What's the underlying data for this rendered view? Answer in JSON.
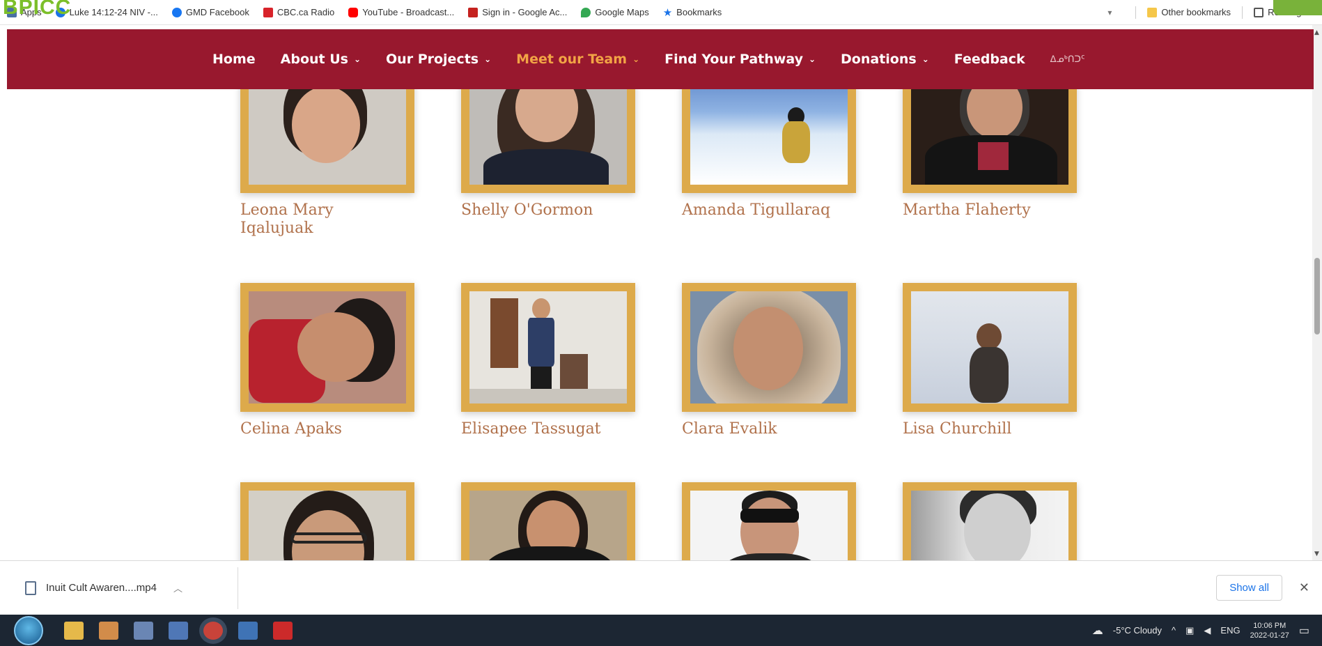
{
  "bookmarks": {
    "items": [
      {
        "label": "Apps",
        "icon": "apps-grid-icon",
        "color": "#4a6fa5"
      },
      {
        "label": "Luke 14:12-24 NIV -...",
        "icon": "bible-icon",
        "color": "#1a73e8"
      },
      {
        "label": "GMD Facebook",
        "icon": "facebook-icon",
        "color": "#1877f2"
      },
      {
        "label": "CBC.ca Radio",
        "icon": "cbc-icon",
        "color": "#d8232a"
      },
      {
        "label": "YouTube - Broadcast...",
        "icon": "youtube-icon",
        "color": "#ff0000"
      },
      {
        "label": "Sign in - Google Ac...",
        "icon": "gmail-icon",
        "color": "#c5221f"
      },
      {
        "label": "Google Maps",
        "icon": "maps-icon",
        "color": "#34a853"
      },
      {
        "label": "Bookmarks",
        "icon": "star-icon",
        "color": "#1a73e8"
      }
    ],
    "other": "Other bookmarks",
    "reading": "Reading list",
    "logo": "BPICC"
  },
  "nav": {
    "items": [
      {
        "label": "Home",
        "caret": ""
      },
      {
        "label": "About Us",
        "caret": "⌄"
      },
      {
        "label": "Our Projects",
        "caret": "⌄"
      },
      {
        "label": "Meet our Team",
        "caret": "⌄"
      },
      {
        "label": "Find Your Pathway",
        "caret": "⌄"
      },
      {
        "label": "Donations",
        "caret": "⌄"
      },
      {
        "label": "Feedback",
        "caret": ""
      }
    ],
    "syllabics": "ᐃᓄᒃᑎᑐᑦ",
    "colors": {
      "bar": "#98182e",
      "active": "#f2a445"
    }
  },
  "team": {
    "members": [
      {
        "name": "Leona Mary Iqalujuak"
      },
      {
        "name": "Shelly O'Gormon"
      },
      {
        "name": "Amanda Tigullaraq"
      },
      {
        "name": "Martha Flaherty"
      },
      {
        "name": "Celina Apaks"
      },
      {
        "name": "Elisapee Tassugat"
      },
      {
        "name": "Clara Evalik"
      },
      {
        "name": "Lisa Churchill"
      },
      {
        "name": ""
      },
      {
        "name": ""
      },
      {
        "name": ""
      },
      {
        "name": ""
      }
    ],
    "frame_color": "#ddaa4b",
    "name_color": "#b0714b"
  },
  "downloads": {
    "file": "Inuit Cult Awaren....mp4",
    "show_all": "Show all"
  },
  "taskbar": {
    "weather": "-5°C Cloudy",
    "lang": "ENG",
    "time": "10:06 PM",
    "date": "2022-01-27"
  }
}
